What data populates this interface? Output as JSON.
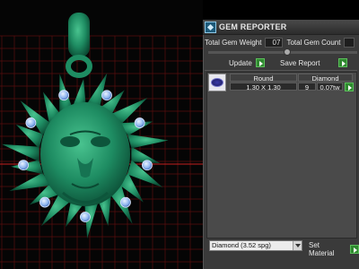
{
  "panel": {
    "title": "GEM REPORTER",
    "total_gem_weight_label": "Total Gem Weight",
    "total_gem_weight_value": "07",
    "total_gem_count_label": "Total Gem Count",
    "update_label": "Update",
    "save_report_label": "Save Report"
  },
  "gem_table": {
    "headers": [
      "Round",
      "Diamond"
    ],
    "row": {
      "size": "1.30 X 1.30",
      "count": "9",
      "weight": "0.07tw"
    }
  },
  "footer": {
    "material_selected": "Diamond     (3.52 spg)",
    "set_material_label": "Set Material"
  },
  "colors": {
    "pendant": "#1e8c62",
    "gems": "#8fb6f0",
    "grid": "#5a0f0f",
    "panel_bg": "#3a3a3a",
    "go_button": "#2f8a2f"
  }
}
